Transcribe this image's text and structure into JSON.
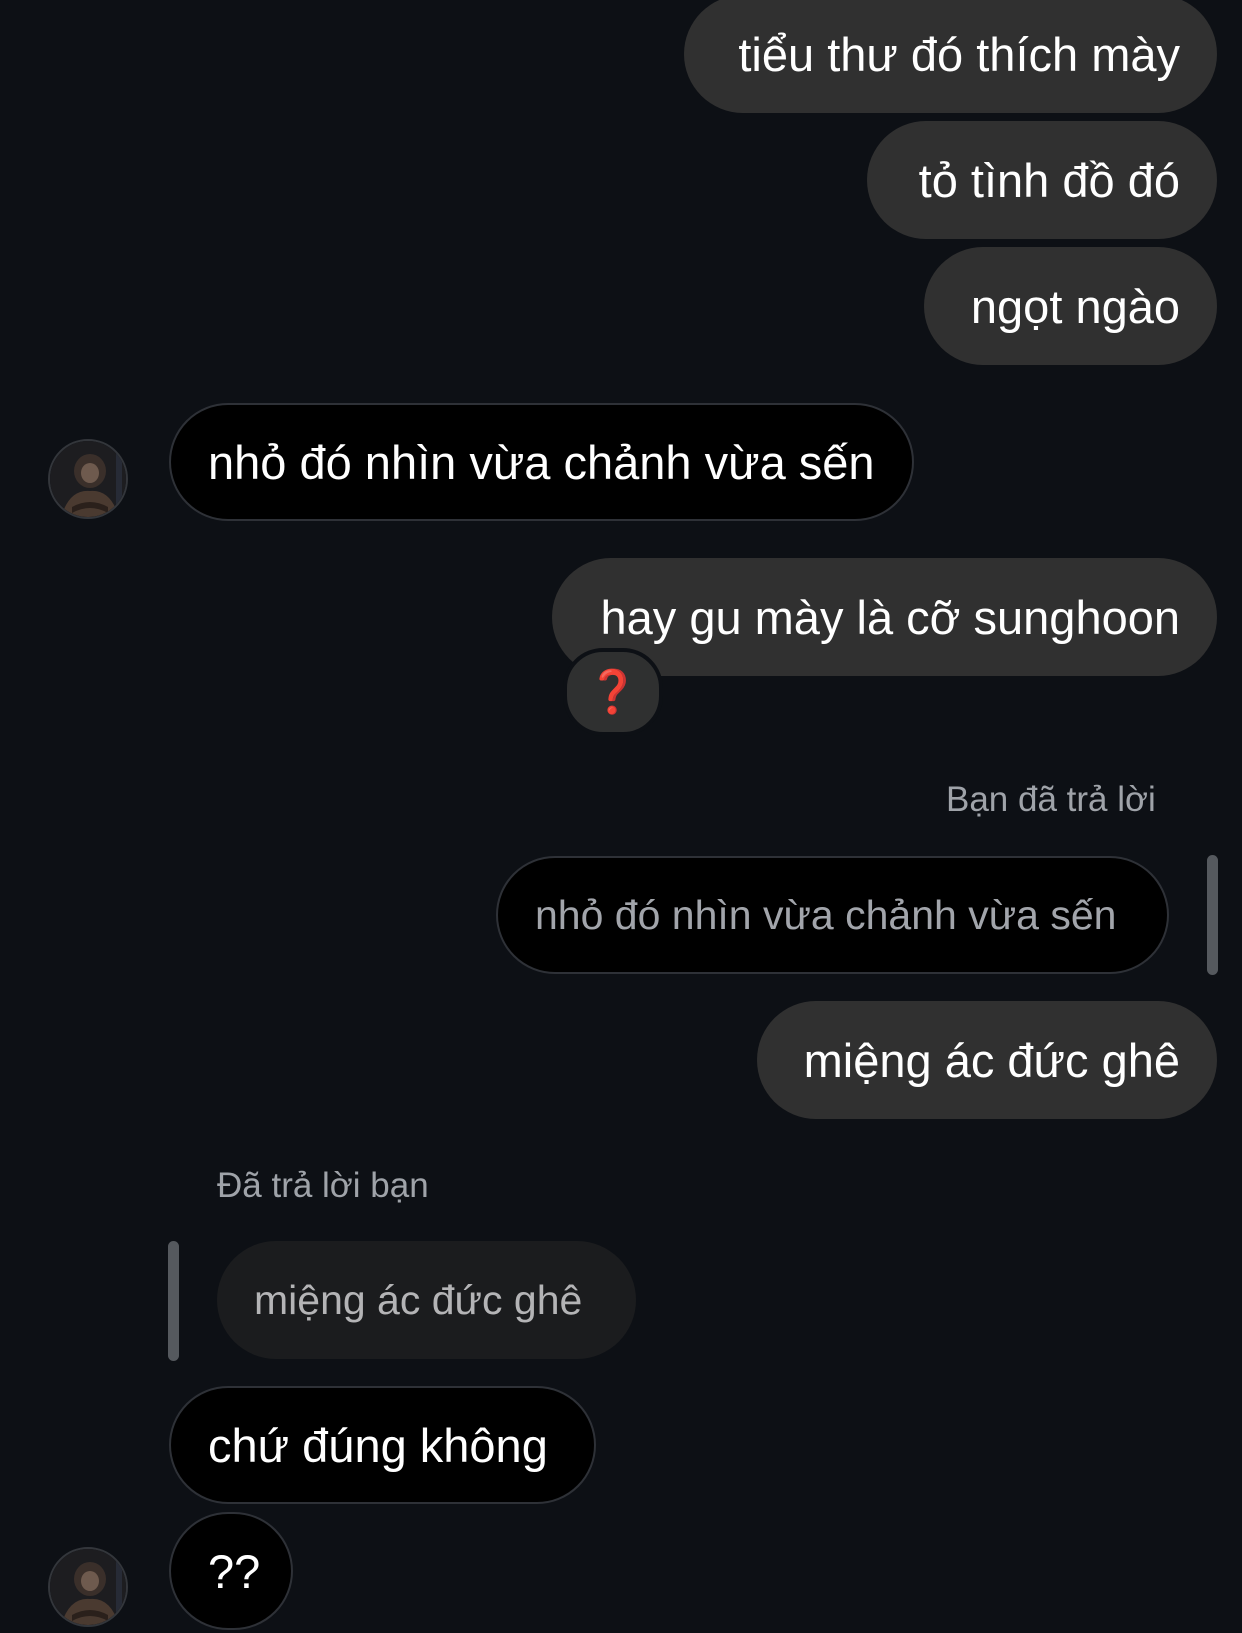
{
  "messages": {
    "m1": "tiểu thư đó thích mày",
    "m2": "tỏ tình đồ đó",
    "m3": "ngọt ngào",
    "m4": "nhỏ đó nhìn vừa chảnh vừa sến",
    "m5": "hay gu mày là cỡ sunghoon",
    "m5_reaction": "❓",
    "reply_label_out": "Bạn đã trả lời",
    "quote_out": "nhỏ đó nhìn vừa chảnh vừa sến",
    "m6": "miệng ác đức ghê",
    "reply_label_in": "Đã trả lời bạn",
    "quote_in": "miệng ác đức ghê",
    "m7": "chứ đúng không",
    "m8": "??"
  },
  "icons": {
    "reaction": "red-question-mark-emoji",
    "avatar": "contact-avatar"
  },
  "colors": {
    "background": "#0d1015",
    "outgoing_bubble": "#303030",
    "incoming_bubble": "#000000",
    "reaction_red": "#d52b2b"
  }
}
